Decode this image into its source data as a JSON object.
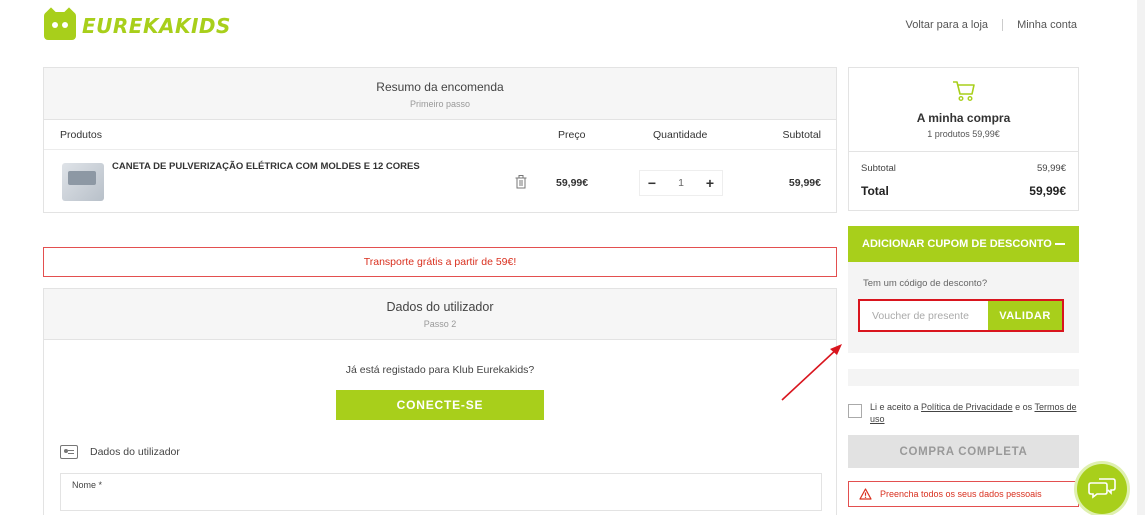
{
  "header": {
    "logo_text": "EUREKAKIDS",
    "links": [
      "Voltar para a loja",
      "Minha conta"
    ]
  },
  "order_summary": {
    "title": "Resumo da encomenda",
    "step": "Primeiro passo",
    "columns": {
      "products": "Produtos",
      "price": "Preço",
      "quantity": "Quantidade",
      "subtotal": "Subtotal"
    },
    "items": [
      {
        "name": "CANETA DE PULVERIZAÇÃO ELÉTRICA COM MOLDES E 12 CORES",
        "price": "59,99€",
        "quantity": "1",
        "subtotal": "59,99€"
      }
    ]
  },
  "shipping_notice": "Transporte grátis a partir de 59€!",
  "user_data": {
    "title": "Dados do utilizador",
    "step": "Passo 2",
    "registered_question": "Já está registado para Klub Eurekakids?",
    "connect_label": "CONECTE-SE",
    "section_label": "Dados do utilizador",
    "name_label": "Nome *"
  },
  "cart": {
    "title": "A minha compra",
    "count": "1 produtos 59,99€",
    "subtotal_label": "Subtotal",
    "subtotal_value": "59,99€",
    "total_label": "Total",
    "total_value": "59,99€"
  },
  "coupon": {
    "header": "ADICIONAR CUPOM DE DESCONTO",
    "question": "Tem um código de desconto?",
    "placeholder": "Voucher de presente",
    "validate_label": "VALIDAR"
  },
  "terms": {
    "prefix": "Li e aceito a ",
    "privacy": "Política de Privacidade",
    "middle": " e os ",
    "terms": "Termos de uso"
  },
  "complete_label": "COMPRA COMPLETA",
  "warning": "Preencha todos os seus dados pessoais",
  "colors": {
    "brand": "#a8cf1b",
    "alert": "#d9151e",
    "muted": "#e2e2e2"
  },
  "icons": [
    "logo-owl-icon",
    "trash-icon",
    "cart-icon",
    "user-card-icon",
    "warning-icon",
    "chat-icon",
    "annotation-arrow"
  ]
}
